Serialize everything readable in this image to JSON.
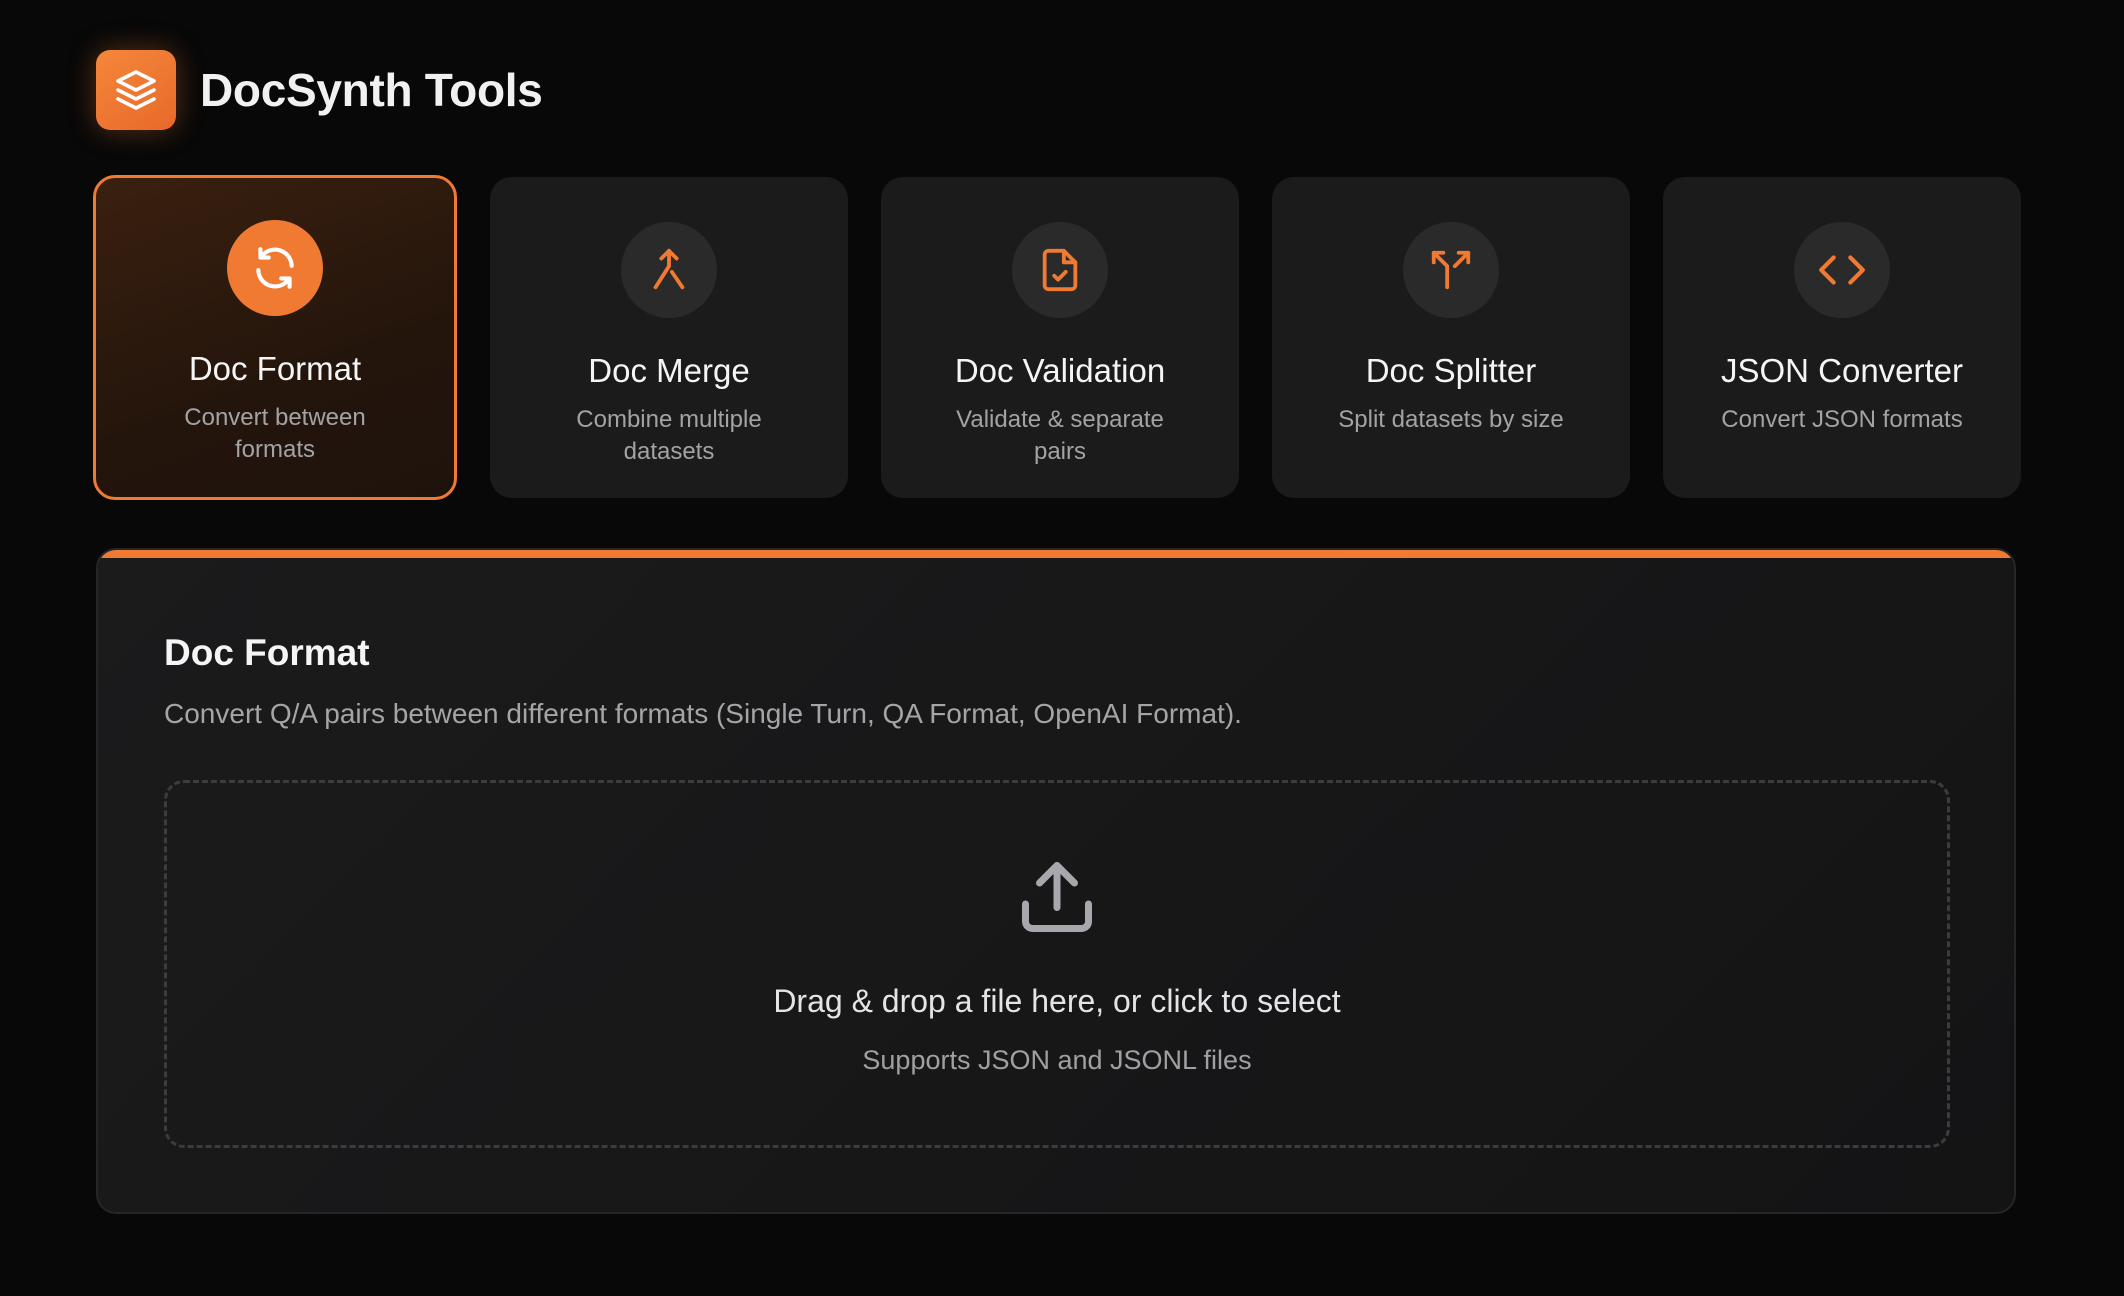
{
  "app": {
    "title": "DocSynth Tools",
    "logo_icon": "layers-icon",
    "accent_color": "#f07a32"
  },
  "tools": [
    {
      "title": "Doc Format",
      "description": "Convert between formats",
      "icon": "refresh-icon",
      "active": true
    },
    {
      "title": "Doc Merge",
      "description": "Combine multiple datasets",
      "icon": "merge-icon",
      "active": false
    },
    {
      "title": "Doc Validation",
      "description": "Validate & separate pairs",
      "icon": "file-check-icon",
      "active": false
    },
    {
      "title": "Doc Splitter",
      "description": "Split datasets by size",
      "icon": "split-icon",
      "active": false
    },
    {
      "title": "JSON Converter",
      "description": "Convert JSON formats",
      "icon": "code-icon",
      "active": false
    }
  ],
  "panel": {
    "title": "Doc Format",
    "description": "Convert Q/A pairs between different formats (Single Turn, QA Format, OpenAI Format).",
    "dropzone": {
      "icon": "upload-icon",
      "main_text": "Drag & drop a file here, or click to select",
      "sub_text": "Supports JSON and JSONL files"
    }
  }
}
